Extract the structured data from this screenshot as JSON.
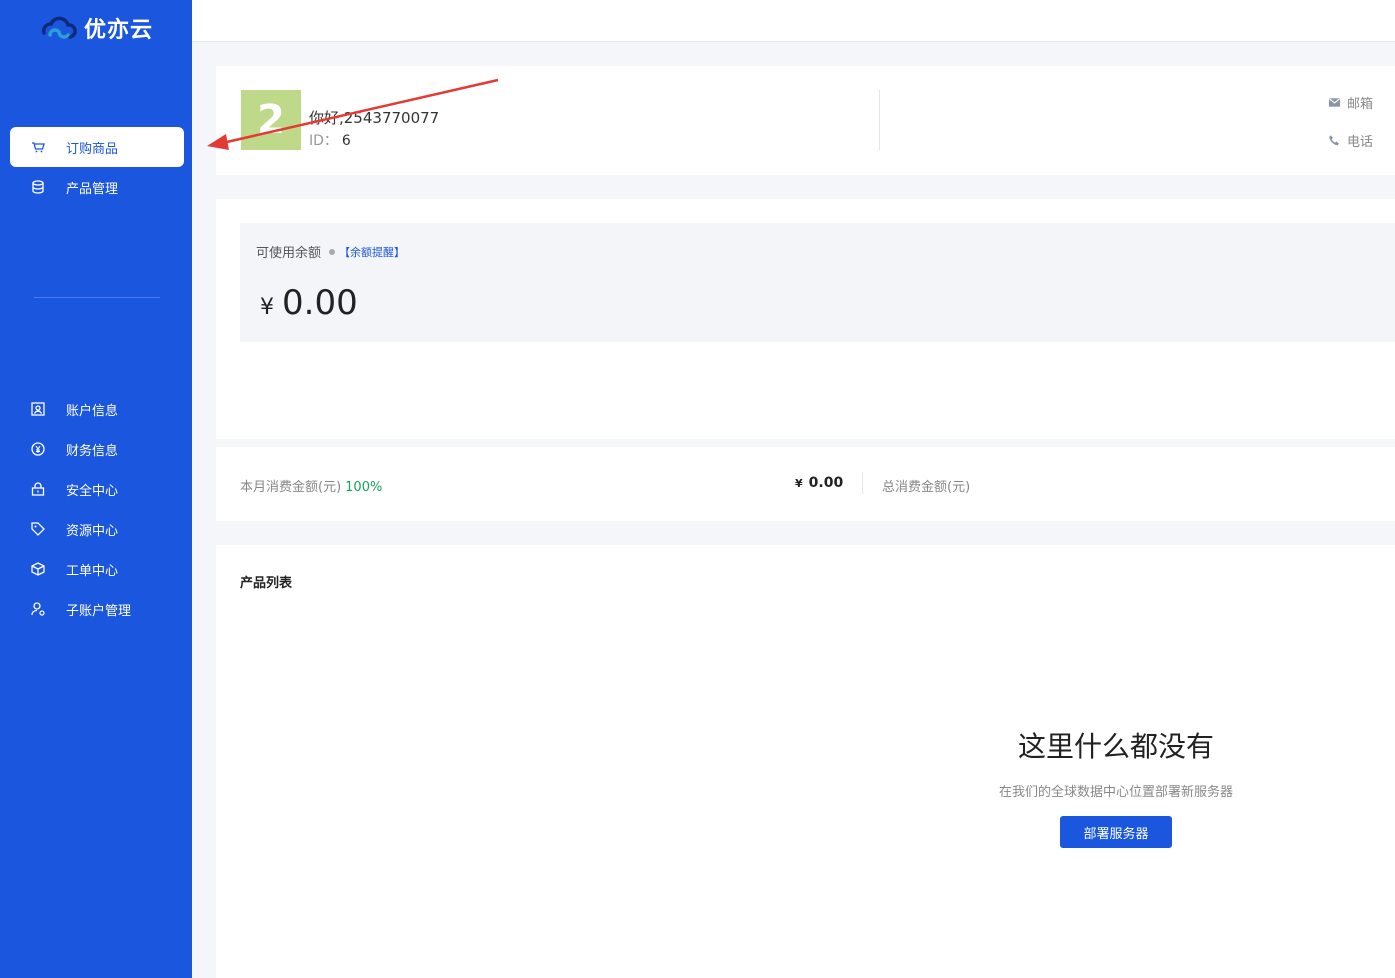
{
  "app": {
    "name": "优亦云"
  },
  "sidebar": {
    "items_top": [
      {
        "label": "订购商品",
        "icon": "cart-icon",
        "active": true
      },
      {
        "label": "产品管理",
        "icon": "database-icon",
        "active": false
      }
    ],
    "items_bottom": [
      {
        "label": "账户信息",
        "icon": "user-card-icon"
      },
      {
        "label": "财务信息",
        "icon": "yuan-coin-icon"
      },
      {
        "label": "安全中心",
        "icon": "lock-icon"
      },
      {
        "label": "资源中心",
        "icon": "tag-icon"
      },
      {
        "label": "工单中心",
        "icon": "box-icon"
      },
      {
        "label": "子账户管理",
        "icon": "sub-user-icon"
      }
    ]
  },
  "user": {
    "avatar_char": "2",
    "greeting": "你好,2543770077",
    "id_label": "ID：",
    "id_value": "6",
    "email_label": "邮箱",
    "phone_label": "电话"
  },
  "balance": {
    "label": "可使用余额",
    "reminder": "【余额提醒】",
    "currency": "¥",
    "amount": "0.00"
  },
  "consumption": {
    "month_label": "本月消费金额(元)",
    "month_pct": "100%",
    "currency": "¥",
    "amount": "0.00",
    "total_label": "总消费金额(元)"
  },
  "products": {
    "title": "产品列表",
    "empty_title": "这里什么都没有",
    "empty_subtitle": "在我们的全球数据中心位置部署新服务器",
    "deploy_button": "部署服务器"
  },
  "colors": {
    "sidebar": "#1b56de",
    "accent": "#1b56de",
    "success": "#1aa260",
    "annotation_arrow": "#e53935"
  }
}
